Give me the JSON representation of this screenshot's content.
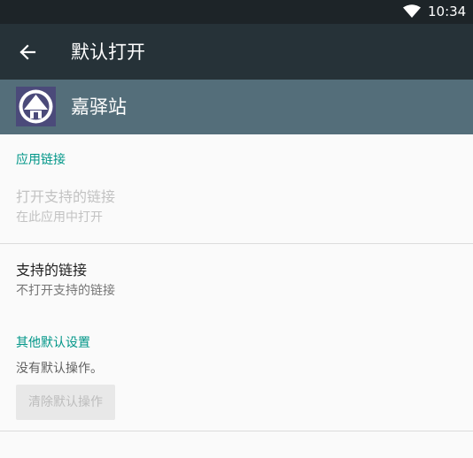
{
  "status_bar": {
    "time": "10:34",
    "wifi_icon": "wifi-icon"
  },
  "toolbar": {
    "back_icon": "arrow-left-icon",
    "title": "默认打开"
  },
  "app": {
    "icon": "app-logo-icon",
    "name": "嘉驿站"
  },
  "app_links": {
    "section_title": "应用链接",
    "open_supported": {
      "title": "打开支持的链接",
      "summary": "在此应用中打开"
    },
    "supported_links": {
      "title": "支持的链接",
      "summary": "不打开支持的链接"
    }
  },
  "other_defaults": {
    "section_title": "其他默认设置",
    "summary": "没有默认操作。",
    "clear_button": "清除默认操作"
  },
  "colors": {
    "status_bar": "#1d2428",
    "toolbar": "#263238",
    "app_header": "#546e7a",
    "accent": "#009688"
  }
}
